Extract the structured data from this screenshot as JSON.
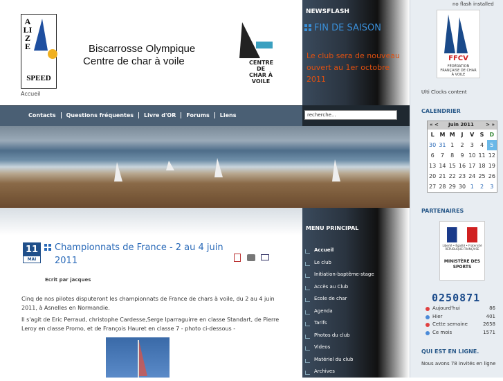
{
  "header": {
    "logo_left_letters": "ALIZE",
    "logo_left_speed": "SPEED",
    "title_line1": "Biscarrosse Olympique",
    "title_line2": "Centre de char à voile",
    "logo_right_text": "CENTRE DE CHAR À VOILE",
    "accueil_link": "Accueil"
  },
  "newsflash": {
    "title": "NEWSFLASH",
    "heading": "FIN DE SAISON",
    "body": "Le club sera de nouveau ouvert au 1er octobre 2011"
  },
  "navbar": {
    "items": [
      "Contacts",
      "Questions fréquentes",
      "Livre d'OR",
      "Forums",
      "Liens"
    ]
  },
  "search": {
    "placeholder": "recherche..."
  },
  "article": {
    "day": "11",
    "month": "MAI",
    "title": "Championnats de France - 2 au 4 juin 2011",
    "author": "Ecrit par jacques",
    "para1": "Cinq de nos pilotes disputeront les championnats de France de chars à voile, du 2 au 4 juin 2011, à Asnelles en Normandie.",
    "para2": "Il s'agit de Eric Perraud, christophe Cardesse,Serge Iparraguirre en classe Standart, de Pierre Leroy en classe Promo, et de François Hauret en classe 7 - photo ci-dessous -"
  },
  "menu": {
    "title": "MENU PRINCIPAL",
    "items": [
      "Accueil",
      "Le club",
      "Initiation-baptême-stage",
      "Accès au Club",
      "Ecole de char",
      "Agenda",
      "Tarifs",
      "Photos du club",
      "Videos",
      "Matériel du club",
      "Archives"
    ]
  },
  "right": {
    "flash_note": "no flash installed",
    "ffcv_text": "FFCV",
    "ffcv_sub": "FÉDÉRATION FRANÇAISE DE CHAR À VOILE",
    "ulti_clocks": "Ulti Clocks content",
    "calendar_title": "CALENDRIER",
    "partners_title": "PARTENAIRES",
    "marianne_rep": "Liberté • Égalité • Fraternité RÉPUBLIQUE FRANÇAISE",
    "marianne_min": "MINISTÈRE DES SPORTS",
    "who_title": "QUI EST EN LIGNE.",
    "who_text": "Nous avons 78 invités en ligne"
  },
  "calendar": {
    "nav_prev": "« <",
    "month": "Juin 2011",
    "nav_next": "> »",
    "day_headers": [
      "L",
      "M",
      "M",
      "J",
      "V",
      "S",
      "D"
    ],
    "weeks": [
      [
        "30",
        "31",
        "1",
        "2",
        "3",
        "4",
        "5"
      ],
      [
        "6",
        "7",
        "8",
        "9",
        "10",
        "11",
        "12"
      ],
      [
        "13",
        "14",
        "15",
        "16",
        "17",
        "18",
        "19"
      ],
      [
        "20",
        "21",
        "22",
        "23",
        "24",
        "25",
        "26"
      ],
      [
        "27",
        "28",
        "29",
        "30",
        "1",
        "2",
        "3"
      ]
    ]
  },
  "counter": {
    "total": "0250871",
    "rows": [
      {
        "label": "Aujourd'hui",
        "value": "86",
        "color": "#e04040"
      },
      {
        "label": "Hier",
        "value": "401",
        "color": "#4a8ad8"
      },
      {
        "label": "Cette semaine",
        "value": "2658",
        "color": "#e04040"
      },
      {
        "label": "Ce mois",
        "value": "1571",
        "color": "#4a8ad8"
      }
    ]
  }
}
